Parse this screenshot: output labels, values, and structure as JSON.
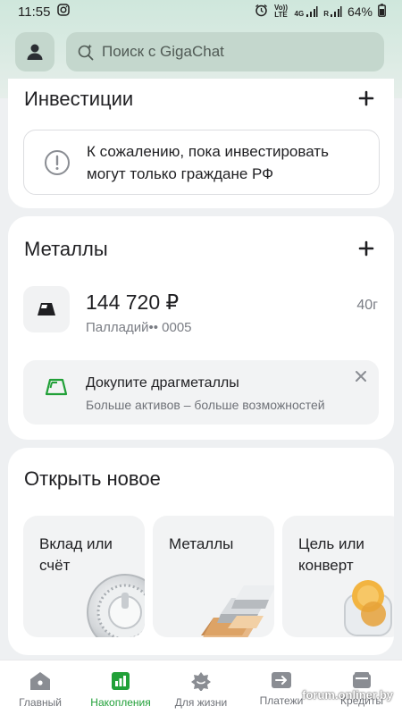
{
  "status_bar": {
    "time": "11:55",
    "lte_label": "Vo)) LTE",
    "net_label": "4G",
    "roaming_label": "R",
    "battery": "64%"
  },
  "header": {
    "search_placeholder": "Поиск с GigaChat"
  },
  "investments": {
    "title": "Инвестиции",
    "notice": "К сожалению, пока инвестировать могут только граждане РФ"
  },
  "metals": {
    "title": "Металлы",
    "amount": "144 720 ₽",
    "account": "Палладий•• 0005",
    "weight": "40г",
    "promo_title": "Докупите драгметаллы",
    "promo_subtitle": "Больше активов – больше возможностей"
  },
  "open_new": {
    "title": "Открыть новое",
    "tiles": [
      {
        "label": "Вклад или счёт"
      },
      {
        "label": "Металлы"
      },
      {
        "label": "Цель или конверт"
      }
    ]
  },
  "bottom_nav": {
    "items": [
      {
        "label": "Главный",
        "icon": "home-icon"
      },
      {
        "label": "Накопления",
        "icon": "savings-chart-icon",
        "active": true
      },
      {
        "label": "Для жизни",
        "icon": "lifestyle-icon"
      },
      {
        "label": "Платежи",
        "icon": "payments-arrow-icon"
      },
      {
        "label": "Кредиты",
        "icon": "credits-wallet-icon"
      }
    ]
  },
  "watermark": "forum.onliner.by",
  "colors": {
    "accent": "#21a038",
    "header_bg": "#cfe7dc",
    "card_bg": "#ffffff",
    "page_bg": "#eef0f2"
  }
}
